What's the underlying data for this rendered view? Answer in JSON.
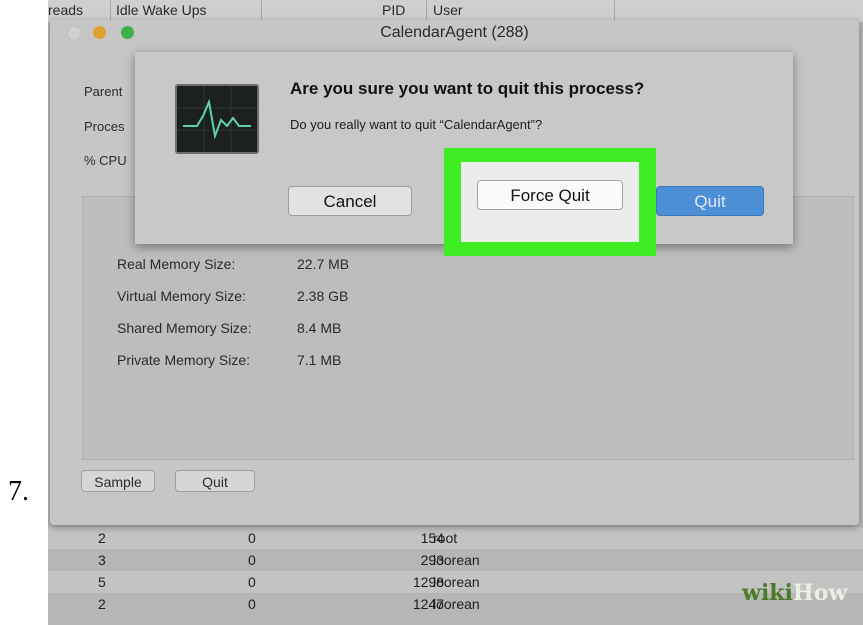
{
  "step_number": "7.",
  "background_header": {
    "col_threads": "reads",
    "col_idle": "Idle Wake Ups",
    "col_pid": "PID",
    "col_user": "User"
  },
  "inspector": {
    "title": "CalendarAgent (288)",
    "info_labels": [
      "Parent",
      "Proces",
      "% CPU"
    ],
    "memory": [
      {
        "label": "Real Memory Size:",
        "value": "22.7 MB"
      },
      {
        "label": "Virtual Memory Size:",
        "value": "2.38 GB"
      },
      {
        "label": "Shared Memory Size:",
        "value": "8.4 MB"
      },
      {
        "label": "Private Memory Size:",
        "value": "7.1 MB"
      }
    ],
    "sample_button": "Sample",
    "quit_button": "Quit"
  },
  "dialog": {
    "title": "Are you sure you want to quit this process?",
    "message": "Do you really want to quit “CalendarAgent”?",
    "cancel_label": "Cancel",
    "force_quit_label": "Force Quit",
    "quit_label": "Quit",
    "icon": "activity-monitor-icon"
  },
  "process_rows": [
    {
      "threads": "2",
      "idle": "0",
      "pid": "154",
      "user": "root"
    },
    {
      "threads": "3",
      "idle": "0",
      "pid": "293",
      "user": "loorean"
    },
    {
      "threads": "5",
      "idle": "0",
      "pid": "1298",
      "user": "loorean"
    },
    {
      "threads": "2",
      "idle": "0",
      "pid": "1247",
      "user": "loorean"
    }
  ],
  "watermark": {
    "part1": "wiki",
    "part2": "How"
  },
  "colors": {
    "highlight": "#3fee22",
    "quit_button": "#4d8fd6"
  }
}
